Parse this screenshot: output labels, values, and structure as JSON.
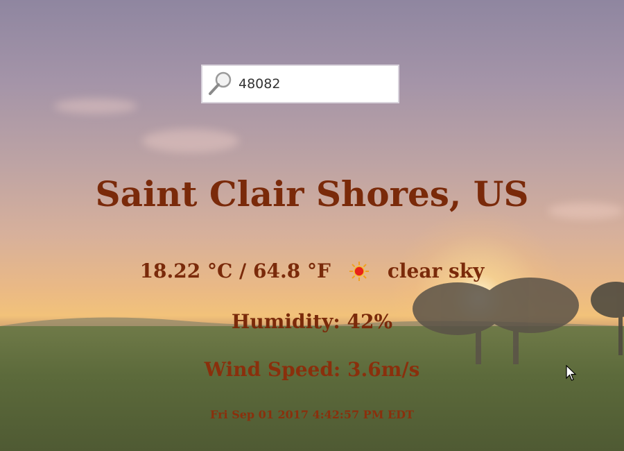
{
  "search": {
    "value": "48082"
  },
  "weather": {
    "city": "Saint Clair Shores, US",
    "temperature": "18.22 °C / 64.8 °F",
    "condition": "clear sky",
    "condition_icon": "sun-icon",
    "humidity": "Humidity: 42%",
    "wind_speed": "Wind Speed: 3.6m/s",
    "timestamp": "Fri Sep 01 2017 4:42:57 PM EDT"
  },
  "colors": {
    "text": "#7a2a0a",
    "sun_core": "#e8231a",
    "sun_rays": "#f0a020"
  }
}
